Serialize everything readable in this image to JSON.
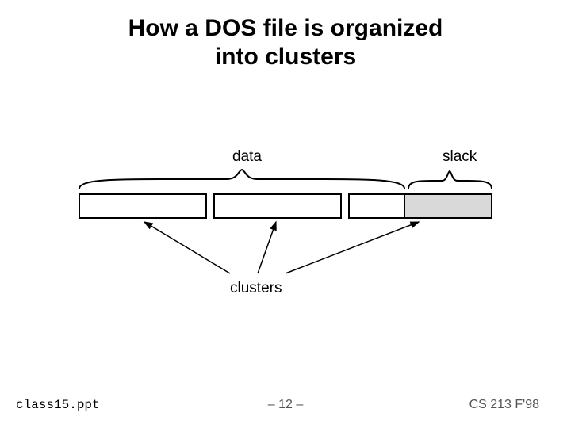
{
  "title_line1": "How a DOS file is organized",
  "title_line2": "into clusters",
  "labels": {
    "data": "data",
    "slack": "slack",
    "clusters": "clusters"
  },
  "footer": {
    "filename": "class15.ppt",
    "page": "– 12 –",
    "course": "CS 213 F'98"
  }
}
